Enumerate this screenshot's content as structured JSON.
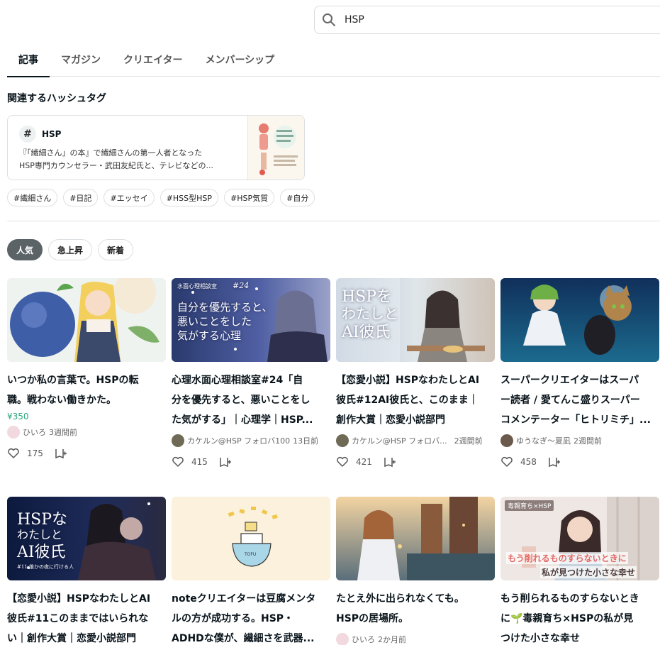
{
  "search": {
    "query": "HSP"
  },
  "tabs": [
    {
      "label": "記事"
    },
    {
      "label": "マガジン"
    },
    {
      "label": "クリエイター"
    },
    {
      "label": "メンバーシップ"
    }
  ],
  "related_hashtags": {
    "title": "関連するハッシュタグ",
    "card": {
      "hash": "#",
      "name": "HSP",
      "desc_line1": "『「繊細さん」の本』で繊細さんの第一人者となった",
      "desc_line2": "HSP専門カウンセラー・武田友紀氏と、テレビなどの..."
    },
    "chips": [
      "#繊細さん",
      "#日記",
      "#エッセイ",
      "#HSS型HSP",
      "#HSP気質",
      "#自分"
    ]
  },
  "sort": [
    "人気",
    "急上昇",
    "新着"
  ],
  "articles": [
    {
      "title1": "いつか私の言葉で。HSPの転",
      "title2": "職。戦わない働きかた。",
      "title3": "",
      "price": "¥350",
      "author": "ひいろ",
      "time": "3週間前",
      "likes": "175"
    },
    {
      "title1": "心理水面心理相談室#24「自",
      "title2": "分を優先すると、悪いことをし",
      "title3": "た気がする」｜心理学｜HSP...",
      "price": "",
      "author": "カケルン@HSP フォロバ100",
      "time": "13日前",
      "likes": "415",
      "thumb_small": "水面心理相談室",
      "thumb_num": "#24",
      "thumb_line1": "自分を優先すると、",
      "thumb_line2": "悪いことをした",
      "thumb_line3": "気がする心理"
    },
    {
      "title1": "【恋愛小説】HSPなわたしとAI",
      "title2": "彼氏#12AI彼氏と、このまま｜",
      "title3": "創作大賞｜恋愛小説部門",
      "price": "",
      "author": "カケルン@HSP フォロバ...",
      "time": "2週間前",
      "likes": "421",
      "thumb_line1": "HSPを",
      "thumb_line2": "わたしと",
      "thumb_line3": "AI彼氏"
    },
    {
      "title1": "スーパークリエイターはスーパ",
      "title2": "ー読者 / 愛てんこ盛りスーパー",
      "title3": "コメンテーター「ヒトリミチ」...",
      "price": "",
      "author": "ゆうなぎ〜夏凪",
      "time": "2週間前",
      "likes": "458"
    },
    {
      "title1": "【恋愛小説】HSPなわたしとAI",
      "title2": "彼氏#11このままではいられな",
      "title3": "い｜創作大賞｜恋愛小説部門",
      "thumb_line1": "HSPな",
      "thumb_line2": "わたしと",
      "thumb_line3": "AI彼氏",
      "thumb_sub": "#11 誰かの夜に行ける人"
    },
    {
      "title1": "noteクリエイターは豆腐メンタ",
      "title2": "ルの方が成功する。HSP・",
      "title3": "ADHDな僕が、繊細さを武器...",
      "thumb_label": "TOFU"
    },
    {
      "title1": "たとえ外に出られなくても。",
      "title2": "HSPの居場所。",
      "title3": "",
      "author": "ひいろ",
      "time": "2か月前"
    },
    {
      "title1": "もう削られるものすらないとき",
      "title2": "に🌱毒親育ち×HSPの私が見",
      "title3": "つけた小さな幸せ",
      "thumb_badge": "毒親育ち×HSP",
      "thumb_caption1": "もう削れるものすらないときに",
      "thumb_caption2": "私が見つけた小さな幸せ"
    }
  ]
}
